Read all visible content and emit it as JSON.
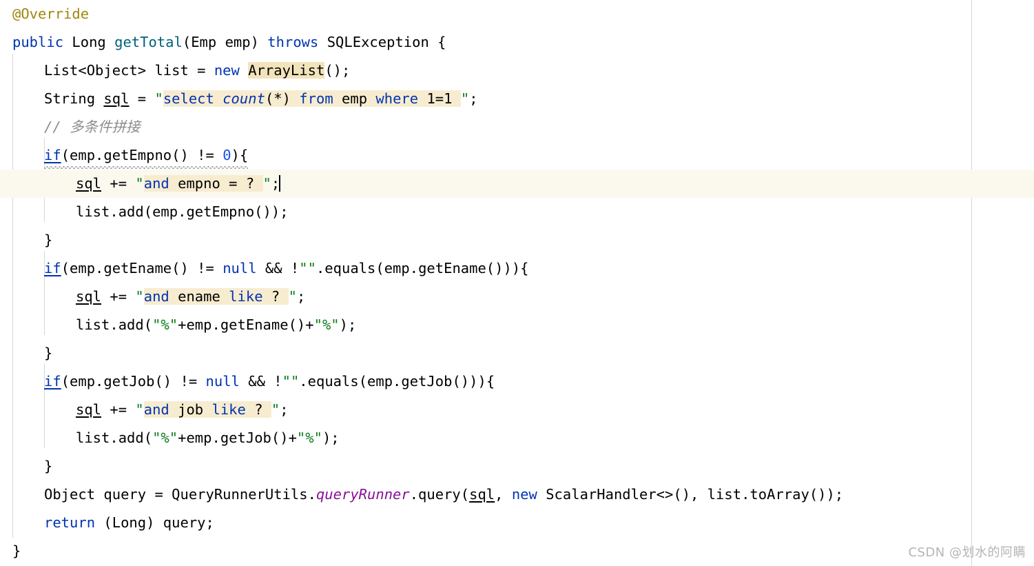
{
  "editor": {
    "language": "Java",
    "background": "#ffffff",
    "caret_line_background": "#fbf9ee",
    "match_highlight_color": "#f2e3bb",
    "margin_guide_color": "#d4d4d4",
    "indent_guide_color": "#d6d6d6"
  },
  "colors": {
    "keyword": "#0033b3",
    "annotation": "#9e880d",
    "method_declaration": "#00627a",
    "string": "#067d17",
    "number": "#1750eb",
    "comment": "#8c8c8c",
    "static_field": "#871094",
    "plain_text": "#000000"
  },
  "code": {
    "line1": {
      "annotation": "@Override"
    },
    "line2": {
      "kw_public": "public",
      "type_long": " Long ",
      "method_name": "getTotal",
      "params": "(Emp emp) ",
      "kw_throws": "throws",
      "tail": " SQLException {"
    },
    "line3": {
      "prefix": "List<Object> list = ",
      "kw_new": "new",
      "space": " ",
      "match": "ArrayList",
      "suffix": "();"
    },
    "line4": {
      "prefix": "String ",
      "var": "sql",
      "eq": " = ",
      "quote_open": "\"",
      "sql_select": "select",
      "sql_space1": " ",
      "sql_count": "count",
      "sql_star": "(*) ",
      "sql_from": "from",
      "sql_emp": " emp ",
      "sql_where": "where",
      "sql_space2": " ",
      "sql_cond": "1=1",
      "sql_trailing": " ",
      "quote_close": "\"",
      "semi": ";"
    },
    "line5": {
      "comment": "// 多条件拼接"
    },
    "line6": {
      "kw_if": "if",
      "expr_a": "(emp.getEmpno() != ",
      "num_zero": "0",
      "expr_b": "){"
    },
    "line7": {
      "var": "sql",
      "op": " += ",
      "quote_open": "\"",
      "sql_and": "and",
      "sql_body": " empno = ? ",
      "quote_close": "\"",
      "semi": ";"
    },
    "line8": {
      "text": "list.add(emp.getEmpno());"
    },
    "line9": {
      "text": "}"
    },
    "line10": {
      "kw_if": "if",
      "expr_a": "(emp.getEname() != ",
      "kw_null": "null",
      "expr_b": " && !",
      "empty_str": "\"\"",
      "expr_c": ".equals(emp.getEname())){"
    },
    "line11": {
      "var": "sql",
      "op": " += ",
      "quote_open": "\"",
      "sql_and": "and",
      "sql_col": " ename ",
      "sql_like": "like",
      "sql_tail": " ? ",
      "quote_close": "\"",
      "semi": ";"
    },
    "line12": {
      "prefix": "list.add(",
      "pct_open": "\"%\"",
      "mid": "+emp.getEname()+",
      "pct_close": "\"%\"",
      "suffix": ");"
    },
    "line13": {
      "text": "}"
    },
    "line14": {
      "kw_if": "if",
      "expr_a": "(emp.getJob() != ",
      "kw_null": "null",
      "expr_b": " && !",
      "empty_str": "\"\"",
      "expr_c": ".equals(emp.getJob())){"
    },
    "line15": {
      "var": "sql",
      "op": " += ",
      "quote_open": "\"",
      "sql_and": "and",
      "sql_col": " job ",
      "sql_like": "like",
      "sql_tail": " ? ",
      "quote_close": "\"",
      "semi": ";"
    },
    "line16": {
      "prefix": "list.add(",
      "pct_open": "\"%\"",
      "mid": "+emp.getJob()+",
      "pct_close": "\"%\"",
      "suffix": ");"
    },
    "line17": {
      "text": "}"
    },
    "line18": {
      "prefix": "Object query = QueryRunnerUtils.",
      "static_field": "queryRunner",
      "mid": ".query(",
      "var": "sql",
      "comma": ", ",
      "kw_new": "new",
      "tail": " ScalarHandler<>(), list.toArray());"
    },
    "line19": {
      "kw_return": "return",
      "tail": " (Long) query;"
    },
    "line20": {
      "text": "}"
    }
  },
  "watermark": {
    "text": "CSDN @划水的阿瞒"
  }
}
